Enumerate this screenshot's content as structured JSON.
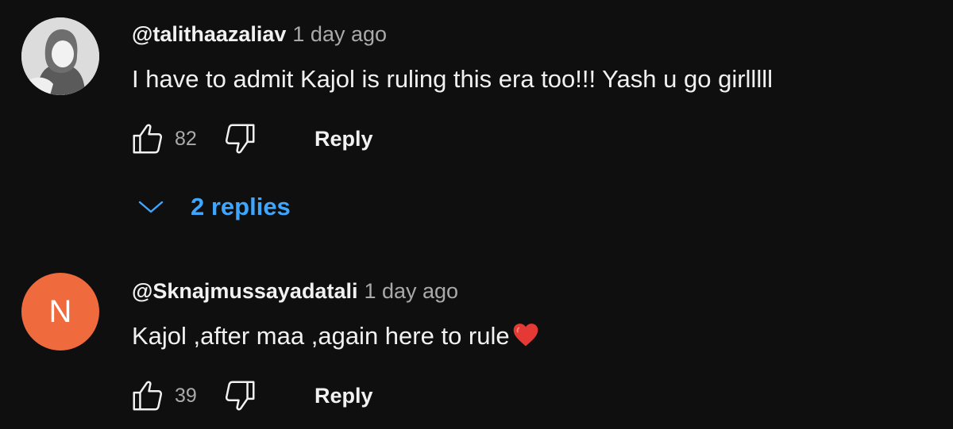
{
  "comments": [
    {
      "author": "@talithaazaliav",
      "time": "1 day ago",
      "text": "I have to admit Kajol is ruling this era too!!! Yash u go girlllll",
      "likes": "82",
      "reply_label": "Reply",
      "avatar": "profile-photo",
      "replies_label": "2 replies"
    },
    {
      "author": "@Sknajmussayadatali",
      "time": "1 day ago",
      "text": "Kajol ,after maa ,again here to rule",
      "emoji": "red-heart-icon",
      "likes": "39",
      "reply_label": "Reply",
      "avatar_letter": "N",
      "avatar_color": "#ef6a3c"
    }
  ],
  "colors": {
    "background": "#0f0f0f",
    "link": "#3ea6ff",
    "muted": "#aaaaaa"
  }
}
